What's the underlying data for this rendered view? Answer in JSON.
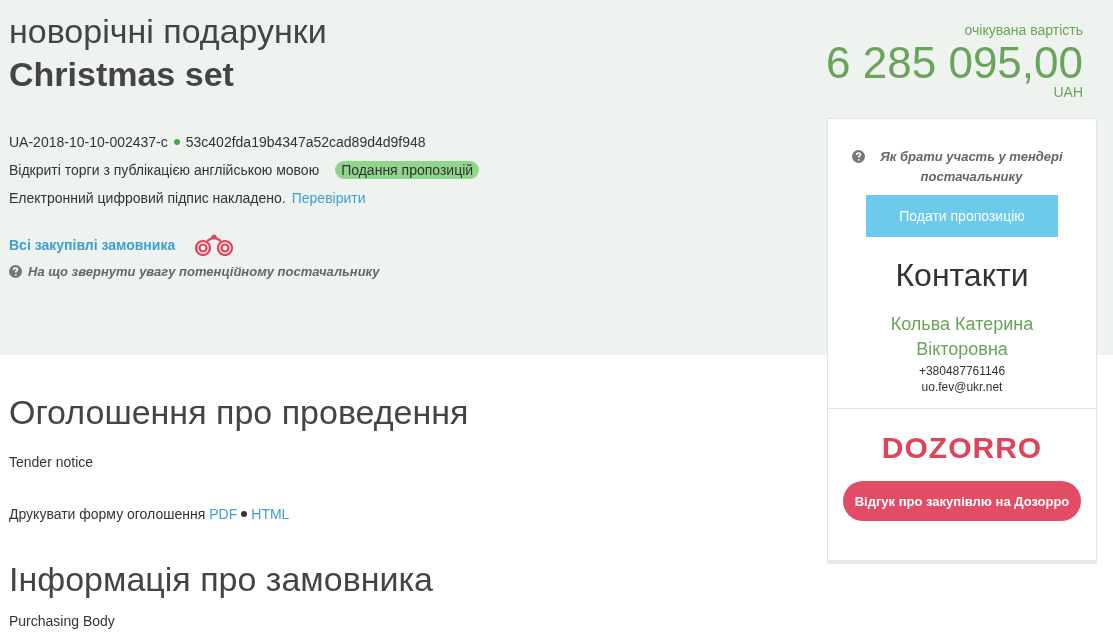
{
  "header": {
    "title": "новорічні подарунки",
    "subtitle": "Christmas set",
    "tender_id": "UA-2018-10-10-002437-c",
    "hash": "53c402fda19b4347a52cad89d4d9f948",
    "procedure": "Відкриті торги з публікацією англійською мовою",
    "status_badge": "Подання пропозицій",
    "signature_text": "Електронний цифровий підпис накладено.",
    "signature_link": "Перевірити",
    "buyer_link": "Всі закупівлі замовника",
    "hint": "На що звернути увагу потенційному постачальнику"
  },
  "budget": {
    "label": "очікувана вартість",
    "amount": "6 285 095,00",
    "currency": "UAH"
  },
  "sidebar": {
    "help": "Як брати участь у тендері постачальнику",
    "submit_button": "Подати пропозицію",
    "contacts_title": "Контакти",
    "contact_name": "Кольва Катерина Вікторовна",
    "phone": "+380487761146",
    "email": "uo.fev@ukr.net",
    "logo": "DOZORRO",
    "review_button": "Відгук про закупівлю на Дозорро"
  },
  "content": {
    "notice_title": "Оголошення про проведення",
    "notice_subtitle": "Tender notice",
    "print_label": "Друкувати форму оголошення",
    "print_links": [
      "PDF",
      "HTML"
    ],
    "buyer_title": "Інформація про замовника",
    "buyer_subtitle": "Purchasing Body"
  }
}
